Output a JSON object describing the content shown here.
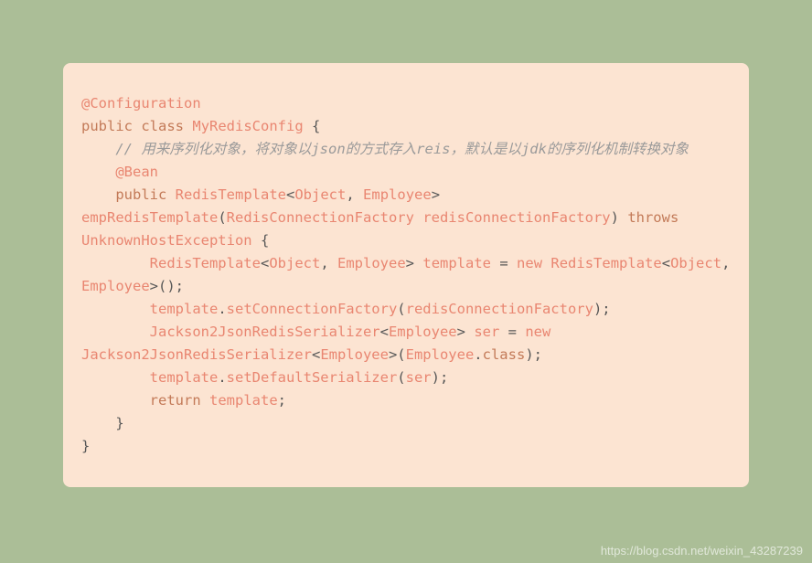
{
  "code": {
    "t01": "@Configuration",
    "t02": "public",
    "t03": "class",
    "t04": "MyRedisConfig",
    "t05": "{",
    "t06": "// 用来序列化对象，将对象以json的方式存入reis，默认是以jdk的序列化机制转换对象",
    "t07": "@Bean",
    "t08": "public",
    "t09": "RedisTemplate",
    "t10": "<",
    "t11": "Object",
    "t12": ",",
    "t13": "Employee",
    "t14": ">",
    "t15": "empRedisTemplate",
    "t16": "(",
    "t17": "RedisConnectionFactory",
    "t18": "redisConnectionFactory",
    "t19": ")",
    "t20": "throws",
    "t21": "UnknownHostException",
    "t22": "{",
    "t23": "RedisTemplate",
    "t24": "<",
    "t25": "Object",
    "t26": ",",
    "t27": "Employee",
    "t28": ">",
    "t29": "template",
    "t30": "=",
    "t31": "new",
    "t32": "RedisTemplate",
    "t33": "<",
    "t34": "Object",
    "t35": ",",
    "t36": "Employee",
    "t37": ">();",
    "t38": "template",
    "t39": ".",
    "t40": "setConnectionFactory",
    "t41": "(",
    "t42": "redisConnectionFactory",
    "t43": ");",
    "t44": "Jackson2JsonRedisSerializer",
    "t45": "<",
    "t46": "Employee",
    "t47": ">",
    "t48": "ser",
    "t49": "=",
    "t50": "new",
    "t51": "Jackson2JsonRedisSerializer",
    "t52": "<",
    "t53": "Employee",
    "t54": ">(",
    "t55": "Employee",
    "t56": ".",
    "t57": "class",
    "t58": ");",
    "t59": "template",
    "t60": ".",
    "t61": "setDefaultSerializer",
    "t62": "(",
    "t63": "ser",
    "t64": ");",
    "t65": "return",
    "t66": "template",
    "t67": ";",
    "t68": "}",
    "t69": "}"
  },
  "watermark": "https://blog.csdn.net/weixin_43287239"
}
